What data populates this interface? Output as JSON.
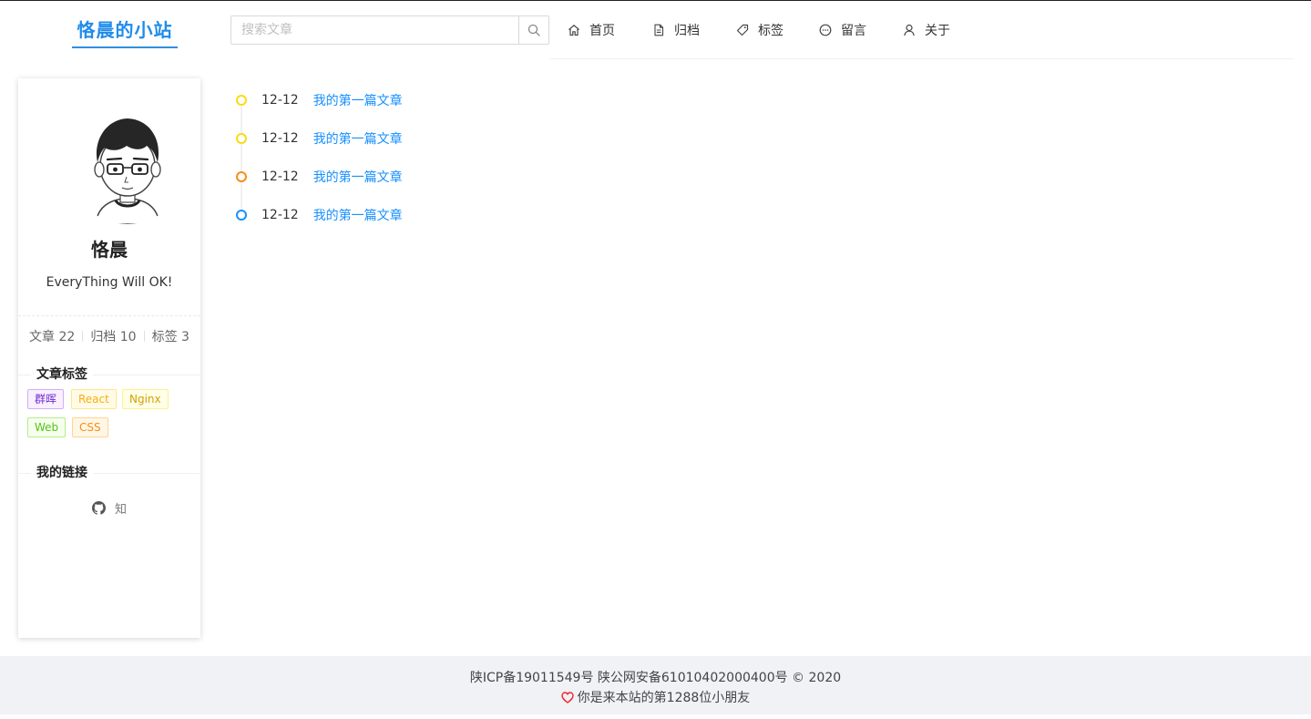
{
  "header": {
    "logo": "恪晨的小站",
    "search": {
      "placeholder": "搜索文章",
      "value": ""
    },
    "nav": [
      {
        "label": "首页",
        "icon": "home-icon"
      },
      {
        "label": "归档",
        "icon": "file-icon"
      },
      {
        "label": "标签",
        "icon": "tag-icon"
      },
      {
        "label": "留言",
        "icon": "message-icon"
      },
      {
        "label": "关于",
        "icon": "user-icon"
      }
    ]
  },
  "sidebar": {
    "name": "恪晨",
    "motto": "EveryThing Will OK!",
    "stats": [
      {
        "label": "文章 22"
      },
      {
        "label": "归档 10"
      },
      {
        "label": "标签 3"
      }
    ],
    "tags_title": "文章标签",
    "tags": [
      {
        "label": "群晖",
        "color": "#722ed1",
        "bg": "#f9f0ff",
        "border": "#d3adf7"
      },
      {
        "label": "React",
        "color": "#faad14",
        "bg": "#fffbe6",
        "border": "#ffe58f"
      },
      {
        "label": "Nginx",
        "color": "#d4a106",
        "bg": "#feffe6",
        "border": "#fff08f"
      },
      {
        "label": "Web",
        "color": "#52c41a",
        "bg": "#f6ffed",
        "border": "#b7eb8f"
      },
      {
        "label": "CSS",
        "color": "#fa8c16",
        "bg": "#fff7e6",
        "border": "#ffd591"
      }
    ],
    "links_title": "我的链接",
    "links": {
      "github_icon": "github-icon",
      "zhihu": "知"
    }
  },
  "timeline": {
    "items": [
      {
        "date": "12-12",
        "title": "我的第一篇文章",
        "dot_color": "#fadb14"
      },
      {
        "date": "12-12",
        "title": "我的第一篇文章",
        "dot_color": "#fadb14"
      },
      {
        "date": "12-12",
        "title": "我的第一篇文章",
        "dot_color": "#fa8c16"
      },
      {
        "date": "12-12",
        "title": "我的第一篇文章",
        "dot_color": "#1890ff"
      }
    ]
  },
  "footer": {
    "icp": "陕ICP备19011549号 陕公网安备61010402000400号 © 2020",
    "visitor": "你是来本站的第1288位小朋友",
    "heart_color": "#f5222d"
  }
}
